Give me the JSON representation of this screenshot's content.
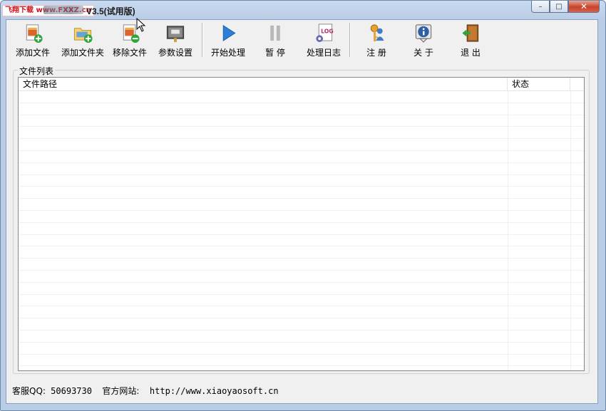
{
  "window": {
    "watermark": "飞翔下载 www.FXXZ.cn",
    "title": "V3.5(试用版)",
    "controls": {
      "minimize": "–",
      "maximize": "□",
      "close": "✕"
    }
  },
  "toolbar": {
    "add_file": "添加文件",
    "add_folder": "添加文件夹",
    "remove_file": "移除文件",
    "settings": "参数设置",
    "start": "开始处理",
    "pause": "暂 停",
    "log": "处理日志",
    "register": "注 册",
    "about": "关 于",
    "exit": "退 出"
  },
  "file_list": {
    "group_title": "文件列表",
    "columns": [
      "文件路径",
      "状态"
    ],
    "rows": []
  },
  "statusbar": {
    "qq_label": "客服QQ:",
    "qq_value": "50693730",
    "site_label": "官方网站:",
    "site_value": "http://www.xiaoyaosoft.cn"
  },
  "colors": {
    "title_accent": "#c9daf0",
    "client_bg": "#f0f0f0",
    "close_button": "#c7432a"
  }
}
